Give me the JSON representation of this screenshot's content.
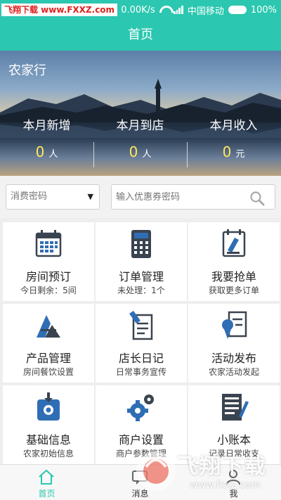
{
  "status_bar": {
    "watermark": "飞翔下载 www.FXXZ.com",
    "speed": "0.00K/s",
    "carrier": "中国移动",
    "battery": "100%"
  },
  "header": {
    "title": "首页"
  },
  "banner": {
    "title": "农家行",
    "stats": [
      {
        "label": "本月新增",
        "value": "0",
        "unit": "人"
      },
      {
        "label": "本月到店",
        "value": "0",
        "unit": "人"
      },
      {
        "label": "本月收入",
        "value": "0",
        "unit": "元"
      }
    ]
  },
  "search": {
    "select_value": "消费密码",
    "coupon_placeholder": "输入优惠券密码"
  },
  "grid": [
    {
      "title": "房间预订",
      "sub": "今日剩余：5间",
      "icon": "calendar-icon"
    },
    {
      "title": "订单管理",
      "sub": "未处理：1个",
      "icon": "calculator-icon"
    },
    {
      "title": "我要抢单",
      "sub": "获取更多订单",
      "icon": "grab-order-icon"
    },
    {
      "title": "产品管理",
      "sub": "房间餐饮设置",
      "icon": "product-icon"
    },
    {
      "title": "店长日记",
      "sub": "日常事务宣传",
      "icon": "diary-icon"
    },
    {
      "title": "活动发布",
      "sub": "农家活动发起",
      "icon": "activity-icon"
    },
    {
      "title": "基础信息",
      "sub": "农家初始信息",
      "icon": "basic-info-icon"
    },
    {
      "title": "商户设置",
      "sub": "商户参数管理",
      "icon": "gear-icon"
    },
    {
      "title": "小账本",
      "sub": "记录日常收支",
      "icon": "ledger-icon"
    }
  ],
  "tabs": [
    {
      "label": "首页",
      "icon": "home-icon",
      "active": true
    },
    {
      "label": "消息",
      "icon": "message-icon",
      "active": false
    },
    {
      "label": "我",
      "icon": "user-icon",
      "active": false
    }
  ],
  "watermark": {
    "text": "飞翔下载",
    "url": "www.fxxz.com"
  },
  "colors": {
    "primary": "#2bc7b0",
    "icon_blue": "#2f6eb5",
    "icon_dark": "#3a4450",
    "highlight": "#ffe85a"
  }
}
